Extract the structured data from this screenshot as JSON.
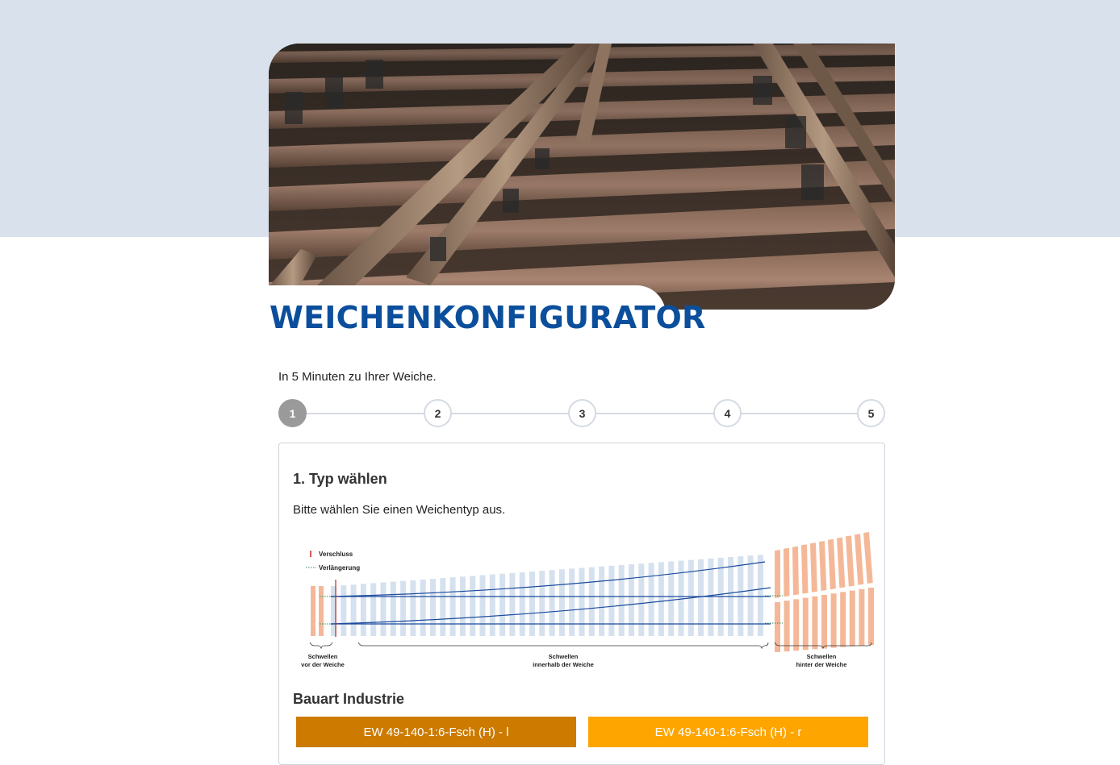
{
  "page": {
    "title": "WEICHENKONFIGURATOR",
    "tagline": "In 5 Minuten zu Ihrer Weiche."
  },
  "stepper": {
    "steps": [
      "1",
      "2",
      "3",
      "4",
      "5"
    ],
    "active": 1
  },
  "card": {
    "title": "1. Typ wählen",
    "instruction": "Bitte wählen Sie einen Weichentyp aus.",
    "diagram": {
      "legend_lock": "Verschluss",
      "legend_extension": "Verlängerung",
      "label_before_line1": "Schwellen",
      "label_before_line2": "vor der Weiche",
      "label_within_line1": "Schwellen",
      "label_within_line2": "innerhalb der Weiche",
      "label_after_line1": "Schwellen",
      "label_after_line2": "hinter der Weiche"
    },
    "section_title": "Bauart Industrie",
    "options": [
      {
        "label": "EW 49-140-1:6-Fsch (H) - l",
        "color": "#cc7a00"
      },
      {
        "label": "EW 49-140-1:6-Fsch (H) - r",
        "color": "#ffa500"
      }
    ]
  },
  "colors": {
    "brand_blue": "#0b4f9c",
    "band": "#d9e1ec",
    "sleeper_blue": "#d6e1ef",
    "sleeper_orange": "#f4b898",
    "rail": "#1a4a9c",
    "lock": "#d22222",
    "extension": "#2e8b57"
  }
}
